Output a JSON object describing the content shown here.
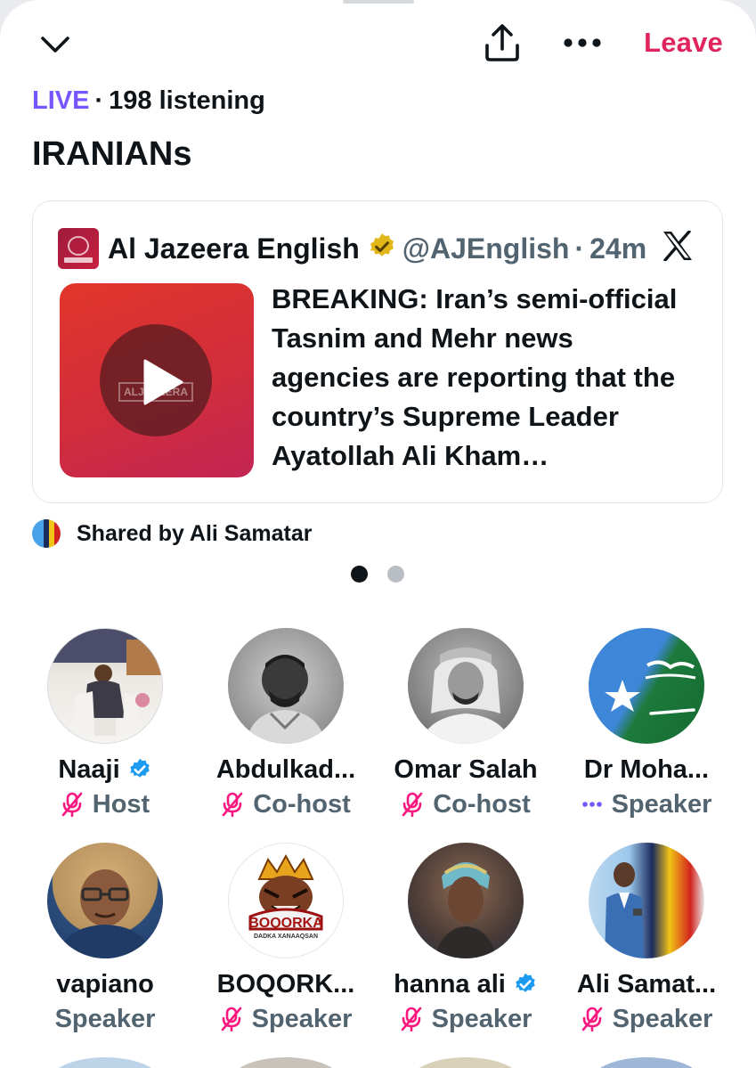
{
  "header": {
    "collapse_icon": "chevron-down-icon",
    "share_icon": "share-upload-icon",
    "more_icon": "more-horizontal-icon",
    "leave_label": "Leave",
    "leave_color": "#e0245e"
  },
  "space": {
    "live_label": "LIVE",
    "listening": "198 listening",
    "title": "IRANIANs",
    "live_color": "#7856ff"
  },
  "pinned_post": {
    "author": "Al Jazeera English",
    "handle": "@AJEnglish",
    "time": "24m",
    "text": "BREAKING: Iran’s semi-official Tasnim and Mehr news agencies are reporting that the country’s Supreme Leader Ayatollah Ali Kham…",
    "media_icon": "play-icon",
    "brand_icon": "x-logo-icon",
    "shared_by": "Shared by Ali Samatar"
  },
  "pager": {
    "pages": 2,
    "active": 1
  },
  "participants": [
    {
      "name": "Naaji",
      "verified": true,
      "role": "Host",
      "role_icon": "mic-muted-icon"
    },
    {
      "name": "Abdulkad...",
      "verified": false,
      "role": "Co-host",
      "role_icon": "mic-muted-icon"
    },
    {
      "name": "Omar Salah",
      "verified": false,
      "role": "Co-host",
      "role_icon": "mic-muted-icon"
    },
    {
      "name": "Dr Moha...",
      "verified": false,
      "role": "Speaker",
      "role_icon": "speaking-dots-icon"
    },
    {
      "name": "vapiano",
      "verified": false,
      "role": "Speaker",
      "role_icon": ""
    },
    {
      "name": "BOQORK...",
      "verified": false,
      "role": "Speaker",
      "role_icon": "mic-muted-icon"
    },
    {
      "name": "hanna ali",
      "verified": true,
      "role": "Speaker",
      "role_icon": "mic-muted-icon"
    },
    {
      "name": "Ali Samat...",
      "verified": false,
      "role": "Speaker",
      "role_icon": "mic-muted-icon"
    }
  ],
  "avatar_art": {
    "boqorka_logo": "BOQORKA",
    "boqorka_sub": "DADKA XANAAQSAN",
    "aj_mark": "ALJAZEERA"
  }
}
